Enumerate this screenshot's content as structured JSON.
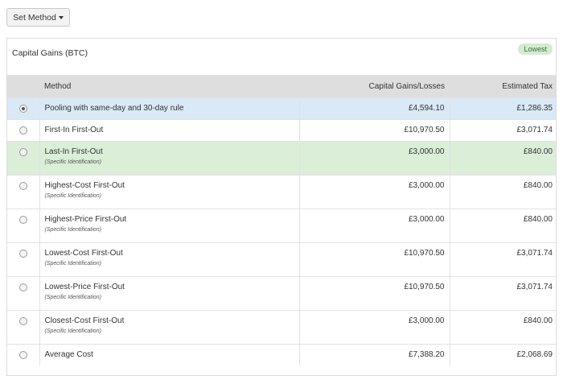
{
  "toolbar": {
    "set_method_label": "Set Method"
  },
  "panel": {
    "title": "Capital Gains (BTC)",
    "badge": "Lowest",
    "columns": {
      "method": "Method",
      "gains": "Capital Gains/Losses",
      "tax": "Estimated Tax"
    },
    "rows": [
      {
        "name": "Pooling with same-day and 30-day rule",
        "sub": "",
        "gains": "£4,594.10",
        "tax": "£1,286.35",
        "selected": true
      },
      {
        "name": "First-In First-Out",
        "sub": "",
        "gains": "£10,970.50",
        "tax": "£3,071.74"
      },
      {
        "name": "Last-In First-Out",
        "sub": "(Specific Identification)",
        "gains": "£3,000.00",
        "tax": "£840.00",
        "lowest": true
      },
      {
        "name": "Highest-Cost First-Out",
        "sub": "(Specific Identification)",
        "gains": "£3,000.00",
        "tax": "£840.00"
      },
      {
        "name": "Highest-Price First-Out",
        "sub": "(Specific Identification)",
        "gains": "£3,000.00",
        "tax": "£840.00"
      },
      {
        "name": "Lowest-Cost First-Out",
        "sub": "(Specific Identification)",
        "gains": "£10,970.50",
        "tax": "£3,071.74"
      },
      {
        "name": "Lowest-Price First-Out",
        "sub": "(Specific Identification)",
        "gains": "£10,970.50",
        "tax": "£3,071.74"
      },
      {
        "name": "Closest-Cost First-Out",
        "sub": "(Specific Identification)",
        "gains": "£3,000.00",
        "tax": "£840.00"
      },
      {
        "name": "Average Cost",
        "sub": "",
        "gains": "£7,388.20",
        "tax": "£2,068.69"
      }
    ]
  }
}
